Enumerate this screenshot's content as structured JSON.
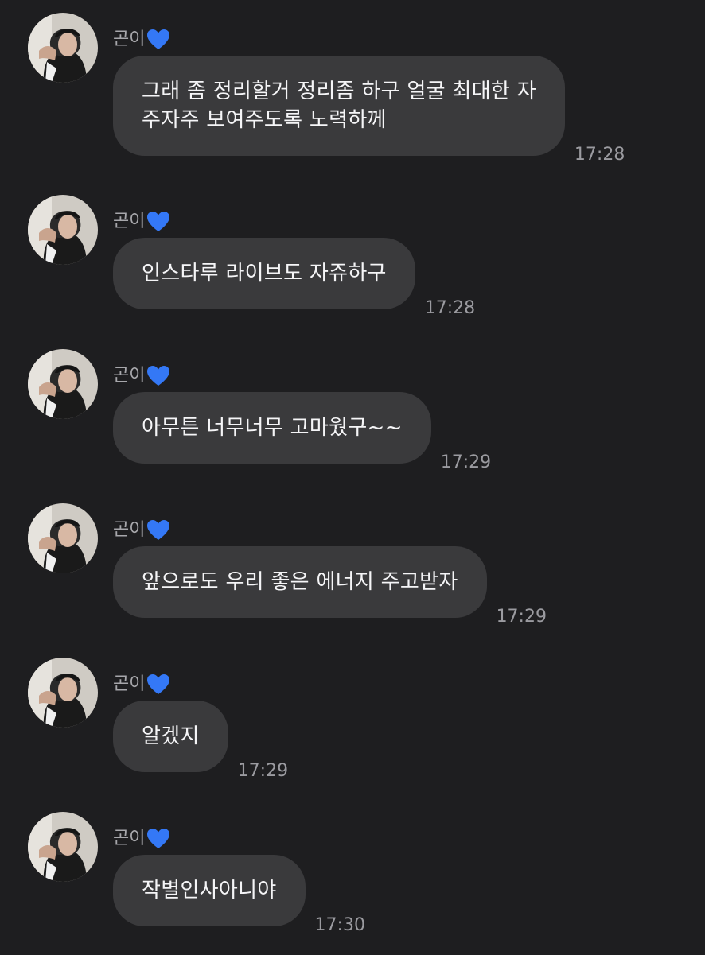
{
  "chat": {
    "messages": [
      {
        "sender": "곤이",
        "sender_icon": "blue-heart-icon",
        "text": "그래 좀 정리할거 정리좀 하구 얼굴 최대한 자\n주자주 보여주도록 노력하께",
        "time": "17:28"
      },
      {
        "sender": "곤이",
        "sender_icon": "blue-heart-icon",
        "text": "인스타루 라이브도 자쥬하구",
        "time": "17:28"
      },
      {
        "sender": "곤이",
        "sender_icon": "blue-heart-icon",
        "text": "아무튼 너무너무 고마웠구~~",
        "time": "17:29"
      },
      {
        "sender": "곤이",
        "sender_icon": "blue-heart-icon",
        "text": "앞으로도 우리 좋은 에너지 주고받자",
        "time": "17:29"
      },
      {
        "sender": "곤이",
        "sender_icon": "blue-heart-icon",
        "text": "알겠지",
        "time": "17:29"
      },
      {
        "sender": "곤이",
        "sender_icon": "blue-heart-icon",
        "text": "작별인사아니야",
        "time": "17:30"
      }
    ]
  },
  "colors": {
    "background": "#1e1e20",
    "bubble": "#3a3a3c",
    "heart": "#3478f6",
    "timestamp": "#9b9ba0"
  }
}
